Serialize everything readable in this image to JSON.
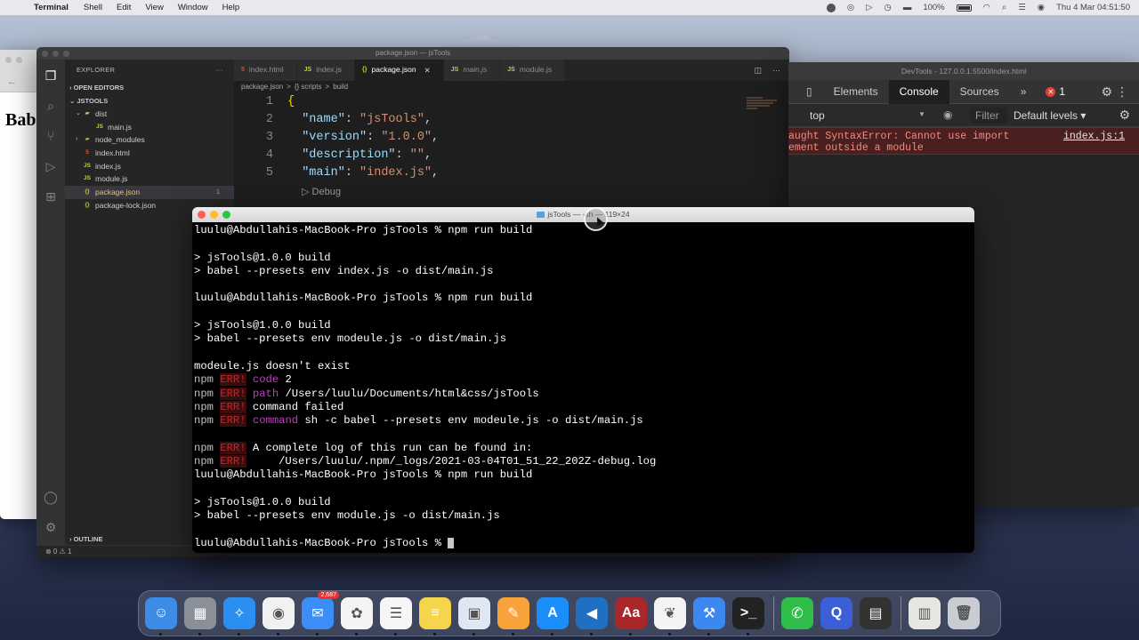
{
  "menubar": {
    "app": "Terminal",
    "items": [
      "Shell",
      "Edit",
      "View",
      "Window",
      "Help"
    ],
    "battery": "100%",
    "clock": "Thu 4 Mar  04:51:50"
  },
  "browser": {
    "visible_text": "Bab"
  },
  "vscode": {
    "title": "package.json — jsTools",
    "sidebar": {
      "header": "EXPLORER",
      "open_editors": "OPEN EDITORS",
      "project": "JSTOOLS",
      "tree": [
        {
          "label": "dist",
          "kind": "folder",
          "indent": 1,
          "chev": "⌄"
        },
        {
          "label": "main.js",
          "kind": "js",
          "indent": 2
        },
        {
          "label": "node_modules",
          "kind": "nm",
          "indent": 1,
          "chev": "›"
        },
        {
          "label": "index.html",
          "kind": "html",
          "indent": 1
        },
        {
          "label": "index.js",
          "kind": "js",
          "indent": 1
        },
        {
          "label": "module.js",
          "kind": "js",
          "indent": 1
        },
        {
          "label": "package.json",
          "kind": "json",
          "indent": 1,
          "selected": true,
          "badge": "1"
        },
        {
          "label": "package-lock.json",
          "kind": "json",
          "indent": 1
        }
      ],
      "outline": "OUTLINE"
    },
    "tabs": [
      {
        "label": "index.html",
        "icon": "5",
        "kind": "html"
      },
      {
        "label": "index.js",
        "icon": "JS",
        "kind": "js"
      },
      {
        "label": "package.json",
        "icon": "{}",
        "kind": "json",
        "active": true
      },
      {
        "label": "main.js",
        "icon": "JS",
        "kind": "js",
        "italic": true
      },
      {
        "label": "module.js",
        "icon": "JS",
        "kind": "js"
      }
    ],
    "breadcrumb": [
      "package.json",
      ">",
      "{} scripts",
      ">",
      "build"
    ],
    "code": [
      {
        "n": "1",
        "parts": [
          [
            "brace",
            "{"
          ]
        ]
      },
      {
        "n": "2",
        "parts": [
          [
            "plain",
            "  "
          ],
          [
            "key",
            "\"name\""
          ],
          [
            "plain",
            ": "
          ],
          [
            "str",
            "\"jsTools\""
          ],
          [
            "plain",
            ","
          ]
        ]
      },
      {
        "n": "3",
        "parts": [
          [
            "plain",
            "  "
          ],
          [
            "key",
            "\"version\""
          ],
          [
            "plain",
            ": "
          ],
          [
            "str",
            "\"1.0.0\""
          ],
          [
            "plain",
            ","
          ]
        ]
      },
      {
        "n": "4",
        "parts": [
          [
            "plain",
            "  "
          ],
          [
            "key",
            "\"description\""
          ],
          [
            "plain",
            ": "
          ],
          [
            "str",
            "\"\""
          ],
          [
            "plain",
            ","
          ]
        ]
      },
      {
        "n": "5",
        "parts": [
          [
            "plain",
            "  "
          ],
          [
            "key",
            "\"main\""
          ],
          [
            "plain",
            ": "
          ],
          [
            "str",
            "\"index.js\""
          ],
          [
            "plain",
            ","
          ]
        ]
      }
    ],
    "debug_lens": "▷ Debug",
    "status": "⊗ 0 ⚠ 1"
  },
  "devtools": {
    "title": "DevTools - 127.0.0.1:5500/index.html",
    "tabs": [
      "Elements",
      "Console",
      "Sources"
    ],
    "active_tab": "Console",
    "error_count": "1",
    "context": "top",
    "filter_placeholder": "Filter",
    "levels": "Default levels ▾",
    "error_line1": "aught SyntaxError: Cannot use import",
    "error_line2": "ement outside a module",
    "error_source": "index.js:1"
  },
  "terminal": {
    "title_left": "jsTools — -",
    "title_mid": "sh",
    "title_right": " — 119×24",
    "lines": [
      [
        [
          "w",
          "luulu@Abdullahis-MacBook-Pro jsTools % npm run build"
        ]
      ],
      [
        [
          "w",
          ""
        ]
      ],
      [
        [
          "w",
          "> jsTools@1.0.0 build"
        ]
      ],
      [
        [
          "w",
          "> babel --presets env index.js -o dist/main.js"
        ]
      ],
      [
        [
          "w",
          ""
        ]
      ],
      [
        [
          "w",
          "luulu@Abdullahis-MacBook-Pro jsTools % npm run build"
        ]
      ],
      [
        [
          "w",
          ""
        ]
      ],
      [
        [
          "w",
          "> jsTools@1.0.0 build"
        ]
      ],
      [
        [
          "w",
          "> babel --presets env modeule.js -o dist/main.js"
        ]
      ],
      [
        [
          "w",
          ""
        ]
      ],
      [
        [
          "w",
          "modeule.js doesn't exist"
        ]
      ],
      [
        [
          "npm",
          "npm"
        ],
        [
          "w",
          " "
        ],
        [
          "err",
          "ERR!"
        ],
        [
          "w",
          " "
        ],
        [
          "mag",
          "code"
        ],
        [
          "w",
          " 2"
        ]
      ],
      [
        [
          "npm",
          "npm"
        ],
        [
          "w",
          " "
        ],
        [
          "err",
          "ERR!"
        ],
        [
          "w",
          " "
        ],
        [
          "mag",
          "path"
        ],
        [
          "w",
          " /Users/luulu/Documents/html&css/jsTools"
        ]
      ],
      [
        [
          "npm",
          "npm"
        ],
        [
          "w",
          " "
        ],
        [
          "err",
          "ERR!"
        ],
        [
          "w",
          " command failed"
        ]
      ],
      [
        [
          "npm",
          "npm"
        ],
        [
          "w",
          " "
        ],
        [
          "err",
          "ERR!"
        ],
        [
          "w",
          " "
        ],
        [
          "mag",
          "command"
        ],
        [
          "w",
          " sh -c babel --presets env modeule.js -o dist/main.js"
        ]
      ],
      [
        [
          "w",
          ""
        ]
      ],
      [
        [
          "npm",
          "npm"
        ],
        [
          "w",
          " "
        ],
        [
          "err",
          "ERR!"
        ],
        [
          "w",
          " A complete log of this run can be found in:"
        ]
      ],
      [
        [
          "npm",
          "npm"
        ],
        [
          "w",
          " "
        ],
        [
          "err",
          "ERR!"
        ],
        [
          "w",
          "     /Users/luulu/.npm/_logs/2021-03-04T01_51_22_202Z-debug.log"
        ]
      ],
      [
        [
          "w",
          "luulu@Abdullahis-MacBook-Pro jsTools % npm run build"
        ]
      ],
      [
        [
          "w",
          ""
        ]
      ],
      [
        [
          "w",
          "> jsTools@1.0.0 build"
        ]
      ],
      [
        [
          "w",
          "> babel --presets env module.js -o dist/main.js"
        ]
      ],
      [
        [
          "w",
          ""
        ]
      ],
      [
        [
          "w",
          "luulu@Abdullahis-MacBook-Pro jsTools % "
        ],
        [
          "cursor",
          ""
        ]
      ]
    ]
  },
  "dock": {
    "apps": [
      {
        "name": "finder-icon",
        "color": "#3d8ce8",
        "glyph": "☺"
      },
      {
        "name": "launchpad-icon",
        "color": "#8a8f98",
        "glyph": "▦"
      },
      {
        "name": "safari-icon",
        "color": "#2a8ff0",
        "glyph": "✧"
      },
      {
        "name": "chrome-icon",
        "color": "#f1f1f1",
        "glyph": "◉"
      },
      {
        "name": "mail-icon",
        "color": "#3a8ef5",
        "glyph": "✉",
        "badge": "2,687"
      },
      {
        "name": "photos-icon",
        "color": "#f4f4f4",
        "glyph": "✿"
      },
      {
        "name": "reminders-icon",
        "color": "#f6f6f6",
        "glyph": "☰"
      },
      {
        "name": "notes-icon",
        "color": "#f5d54c",
        "glyph": "≡"
      },
      {
        "name": "preview-icon",
        "color": "#dfe7f2",
        "glyph": "▣"
      },
      {
        "name": "pages-icon",
        "color": "#f7a33a",
        "glyph": "✎"
      },
      {
        "name": "app-store-icon",
        "color": "#1c8ef9",
        "glyph": "A"
      },
      {
        "name": "vscode-icon",
        "color": "#1f6fc2",
        "glyph": "◀"
      },
      {
        "name": "dictionary-icon",
        "color": "#a9262b",
        "glyph": "Aa"
      },
      {
        "name": "mongodb-icon",
        "color": "#f4f4f4",
        "glyph": "❦"
      },
      {
        "name": "xcode-icon",
        "color": "#3c87f0",
        "glyph": "⚒"
      },
      {
        "name": "terminal-icon",
        "color": "#222",
        "glyph": ">_"
      }
    ],
    "extras": [
      {
        "name": "whatsapp-icon",
        "color": "#2fbe4a",
        "glyph": "✆"
      },
      {
        "name": "quicktime-icon",
        "color": "#3a5fd6",
        "glyph": "Q"
      },
      {
        "name": "calculator-icon",
        "color": "#333",
        "glyph": "▤"
      }
    ],
    "trailing": [
      {
        "name": "downloads-stack-icon",
        "color": "#e8e6e0",
        "glyph": "▥"
      },
      {
        "name": "trash-icon",
        "color": "#c9cdd3",
        "glyph": "🗑"
      }
    ]
  }
}
